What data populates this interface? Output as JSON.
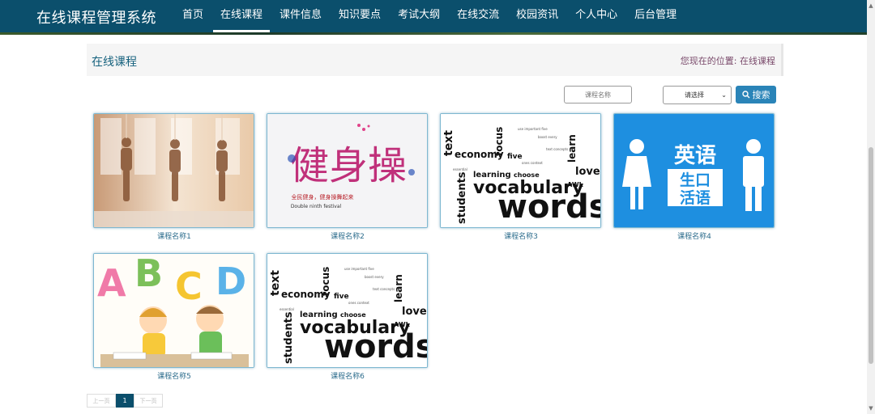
{
  "app": {
    "brand": "在线课程管理系统"
  },
  "nav": {
    "items": [
      "首页",
      "在线课程",
      "课件信息",
      "知识要点",
      "考试大纲",
      "在线交流",
      "校园资讯",
      "个人中心",
      "后台管理"
    ],
    "active_index": 1
  },
  "breadcrumb": {
    "title": "在线课程",
    "location_prefix": "您现在的位置:",
    "location_current": "在线课程"
  },
  "search": {
    "input_placeholder": "课程名称",
    "select_value": "请选择",
    "button_label": "搜索"
  },
  "courses": [
    {
      "name": "课程名称1",
      "image": "yoga-photo"
    },
    {
      "name": "课程名称2",
      "image": "fitness-calligraphy",
      "img_title": "健身操",
      "img_sub": "全民健身，健身操舞起来",
      "img_sub2": "Double ninth festival"
    },
    {
      "name": "课程名称3",
      "image": "vocabulary-wordcloud"
    },
    {
      "name": "课程名称4",
      "image": "english-corner-sign",
      "img_line1": "英语",
      "img_line2": "生口",
      "img_line3": "活语"
    },
    {
      "name": "课程名称5",
      "image": "abcd-kids"
    },
    {
      "name": "课程名称6",
      "image": "vocabulary-wordcloud"
    }
  ],
  "wordcloud": {
    "big1": "vocabulary",
    "big2": "words",
    "w1": "students",
    "w2": "economy",
    "w3": "learning",
    "w4": "focus",
    "w5": "love",
    "w6": "learn",
    "w7": "text",
    "w8": "choose",
    "w9": "AWL",
    "w10": "five"
  },
  "abcd": {
    "letters": [
      "A",
      "B",
      "C",
      "D"
    ]
  },
  "pagination": {
    "prev": "上一页",
    "current": "1",
    "next": "下一页"
  },
  "colors": {
    "nav_bg": "#0b4f6c",
    "accent": "#2a84b8"
  }
}
